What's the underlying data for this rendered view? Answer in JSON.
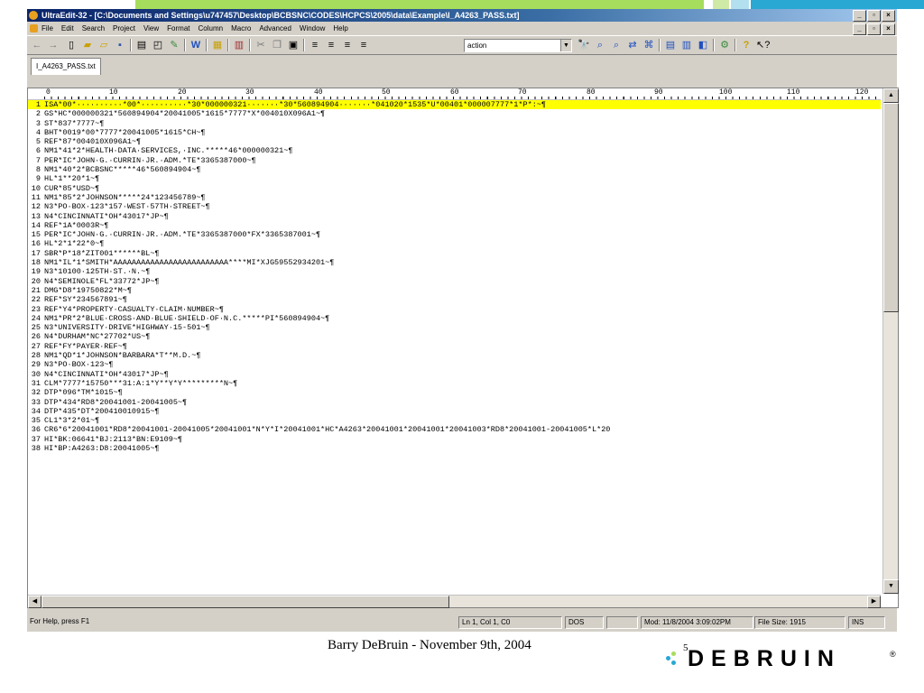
{
  "colors": {
    "titlebar_start": "#0a246a",
    "highlight": "#ffff00",
    "slide_green": "#a7dd5c",
    "slide_blue": "#29a8d3",
    "logo_blue": "#29a8d3",
    "logo_green": "#a7dd5c"
  },
  "window": {
    "title": "UltraEdit-32 - [C:\\Documents and Settings\\u747457\\Desktop\\BCBSNC\\CODES\\HCPCS\\2005\\data\\Example\\I_A4263_PASS.txt]",
    "buttons": {
      "minimize": "_",
      "restore": "▫",
      "close": "×"
    }
  },
  "menu": [
    "File",
    "Edit",
    "Search",
    "Project",
    "View",
    "Format",
    "Column",
    "Macro",
    "Advanced",
    "Window",
    "Help"
  ],
  "toolbar": {
    "combo_value": "action"
  },
  "tab": {
    "label": "I_A4263_PASS.txt"
  },
  "ruler": [
    "0",
    "10",
    "20",
    "30",
    "40",
    "50",
    "60",
    "70",
    "80",
    "90",
    "100",
    "110",
    "120"
  ],
  "lines": [
    "ISA*00*··········*00*··········*30*000000321·······*30*560894904·······*041020*1535*U*00401*000007777*1*P*:~¶",
    "GS*HC*000000321*560894904*20041005*1615*7777*X*004010X096A1~¶",
    "ST*837*7777~¶",
    "BHT*0019*00*7777*20041005*1615*CH~¶",
    "REF*87*004010X096A1~¶",
    "NM1*41*2*HEALTH·DATA·SERVICES,·INC.*****46*000000321~¶",
    "PER*IC*JOHN·G.·CURRIN·JR.·ADM.*TE*3365387000~¶",
    "NM1*40*2*BCBSNC*****46*560894904~¶",
    "HL*1**20*1~¶",
    "CUR*85*USD~¶",
    "NM1*85*2*JOHNSON*****24*123456789~¶",
    "N3*PO·BOX·123*157·WEST·57TH·STREET~¶",
    "N4*CINCINNATI*OH*43017*JP~¶",
    "REF*1A*0003R~¶",
    "PER*IC*JOHN·G.·CURRIN·JR.·ADM.*TE*3365387000*FX*3365387001~¶",
    "HL*2*1*22*0~¶",
    "SBR*P*18*ZIT001******BL~¶",
    "NM1*IL*1*SMITH*AAAAAAAAAAAAAAAAAAAAAAAAA****MI*XJG59552934201~¶",
    "N3*10100·125TH·ST.·N.~¶",
    "N4*SEMINOLE*FL*33772*JP~¶",
    "DMG*D8*19750822*M~¶",
    "REF*SY*234567891~¶",
    "REF*Y4*PROPERTY·CASUALTY·CLAIM·NUMBER~¶",
    "NM1*PR*2*BLUE·CROSS·AND·BLUE·SHIELD·OF·N.C.*****PI*560894904~¶",
    "N3*UNIVERSITY·DRIVE*HIGHWAY·15-501~¶",
    "N4*DURHAM*NC*27702*US~¶",
    "REF*FY*PAYER·REF~¶",
    "NM1*QD*1*JOHNSON*BARBARA*T**M.D.~¶",
    "N3*PO·BOX·123~¶",
    "N4*CINCINNATI*OH*43017*JP~¶",
    "CLM*7777*15750***31:A:1*Y**Y*Y*********N~¶",
    "DTP*096*TM*1015~¶",
    "DTP*434*RD8*20041001-20041005~¶",
    "DTP*435*DT*200410010915~¶",
    "CL1*3*2*01~¶",
    "CR6*6*20041001*RD8*20041001-20041005*20041001*N*Y*I*20041001*HC*A4263*20041001*20041001*20041003*RD8*20041001-20041005*L*20",
    "HI*BK:06641*BJ:2113*BN:E9109~¶",
    "HI*BP:A4263:D8:20041005~¶"
  ],
  "status": {
    "help": "For Help, press F1",
    "position": "Ln 1, Col 1, C0",
    "format": "DOS",
    "modified": "Mod: 11/8/2004 3:09:02PM",
    "filesize": "File Size: 1915",
    "mode": "INS"
  },
  "footer": {
    "text": "Barry DeBruin - November 9th, 2004",
    "page": "5",
    "logo": "DEBRUIN",
    "logo_mark": "®"
  }
}
